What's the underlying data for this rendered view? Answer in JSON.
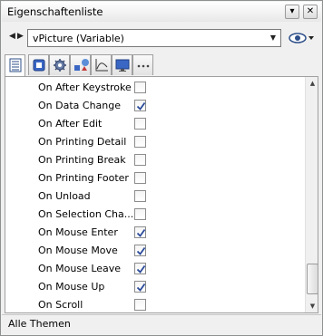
{
  "window": {
    "title": "Eigenschaftenliste",
    "pin_glyph": "▾",
    "close_glyph": "✕"
  },
  "toolbar": {
    "back_glyph": "◀",
    "forward_glyph": "▶",
    "object_select_value": "vPicture (Variable)",
    "dropdown_glyph": "▼",
    "view_icon": "eye-icon"
  },
  "tabs": [
    {
      "icon": "list-icon",
      "active": true
    },
    {
      "icon": "object-icon",
      "active": false
    },
    {
      "icon": "gear-icon",
      "active": false
    },
    {
      "icon": "shapes-icon",
      "active": false
    },
    {
      "icon": "chart-icon",
      "active": false
    },
    {
      "icon": "monitor-icon",
      "active": false
    },
    {
      "icon": "more-icon",
      "active": false
    }
  ],
  "events": [
    {
      "label": "On After Keystroke",
      "checked": false
    },
    {
      "label": "On Data Change",
      "checked": true
    },
    {
      "label": "On After Edit",
      "checked": false
    },
    {
      "label": "On Printing Detail",
      "checked": false
    },
    {
      "label": "On Printing Break",
      "checked": false
    },
    {
      "label": "On Printing Footer",
      "checked": false
    },
    {
      "label": "On Unload",
      "checked": false
    },
    {
      "label": "On Selection Cha...",
      "checked": false
    },
    {
      "label": "On Mouse Enter",
      "checked": true
    },
    {
      "label": "On Mouse Move",
      "checked": true
    },
    {
      "label": "On Mouse Leave",
      "checked": true
    },
    {
      "label": "On Mouse Up",
      "checked": true
    },
    {
      "label": "On Scroll",
      "checked": false
    }
  ],
  "scrollbar": {
    "up_glyph": "▲",
    "down_glyph": "▼"
  },
  "status": {
    "text": "Alle Themen"
  },
  "colors": {
    "check": "#2a4a9a",
    "accent_blue": "#3a66c4"
  }
}
